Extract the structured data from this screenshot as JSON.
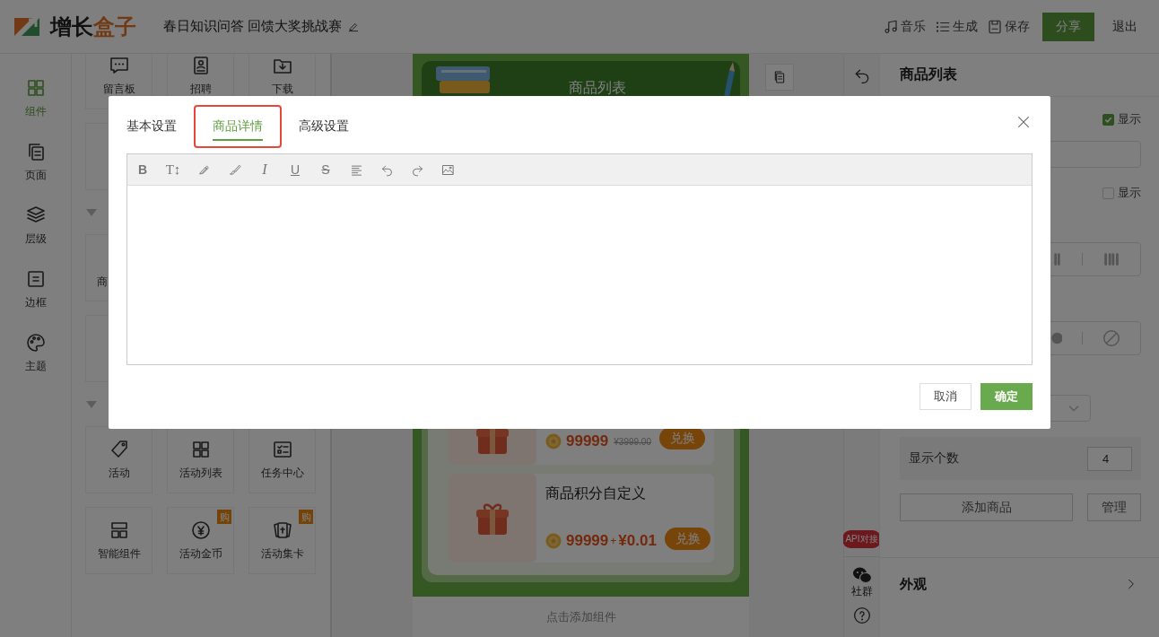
{
  "header": {
    "logo": {
      "text": "增长",
      "accent": "盒子"
    },
    "project_title": "春日知识问答 回馈大奖挑战赛",
    "actions": [
      {
        "kind": "music",
        "label": "音乐"
      },
      {
        "kind": "list",
        "label": "生成"
      },
      {
        "kind": "save",
        "label": "保存"
      }
    ],
    "share_button": "分享",
    "exit_button": "退出"
  },
  "rail": {
    "items": [
      {
        "kind": "grid",
        "label": "组件",
        "selected": true
      },
      {
        "kind": "pages",
        "label": "页面",
        "selected": false
      },
      {
        "kind": "layers",
        "label": "层级",
        "selected": false
      },
      {
        "kind": "border",
        "label": "边框",
        "selected": false
      },
      {
        "kind": "palette",
        "label": "主题",
        "selected": false
      }
    ]
  },
  "component_panel": {
    "rows": [
      {
        "kind": "cards",
        "cards": [
          {
            "kind": "message",
            "label": "留言板"
          },
          {
            "kind": "recruit",
            "label": "招聘"
          },
          {
            "kind": "download",
            "label": "下载"
          }
        ]
      },
      {
        "kind": "cards",
        "cards": [
          {
            "kind": "blank"
          }
        ]
      },
      {
        "kind": "section",
        "expanded": true
      },
      {
        "kind": "cards",
        "cards": [
          {
            "kind": "blank",
            "label": "商"
          }
        ]
      },
      {
        "kind": "cards",
        "cards": [
          {
            "kind": "blank"
          }
        ]
      },
      {
        "kind": "section",
        "expanded": true
      },
      {
        "kind": "cards",
        "cards": [
          {
            "kind": "tag",
            "label": "活动"
          },
          {
            "kind": "grid",
            "label": "活动列表"
          },
          {
            "kind": "tasks",
            "label": "任务中心"
          }
        ]
      },
      {
        "kind": "cards",
        "cards": [
          {
            "kind": "layout",
            "label": "智能组件"
          },
          {
            "kind": "coin",
            "label": "活动金币",
            "badge": "购"
          },
          {
            "kind": "cards",
            "label": "活动集卡",
            "badge": "购"
          }
        ]
      }
    ]
  },
  "canvas": {
    "banner_title": "商品列表",
    "products": [
      {
        "kind": "cut",
        "points": "99999",
        "original_price": "¥3999.00",
        "button": "兑换"
      },
      {
        "kind": "full",
        "name": "商品积分自定义",
        "points": "99999",
        "plus": "+",
        "cash": "¥0.01",
        "button": "兑换"
      }
    ],
    "add_component": "点击添加组件"
  },
  "side_column": {
    "api_badge": "API对接",
    "community": "社群"
  },
  "right_panel": {
    "title": "商品列表",
    "show_first": {
      "label": "显示",
      "checked": true
    },
    "show_second": {
      "label": "显示",
      "checked": false
    },
    "count": {
      "label": "显示个数",
      "value": "4"
    },
    "add_button": "添加商品",
    "manage_button": "管理",
    "appearance": "外观"
  },
  "modal": {
    "tabs": [
      {
        "label": "基本设置",
        "selected": false,
        "highlighted": false
      },
      {
        "label": "商品详情",
        "selected": true,
        "highlighted": true
      },
      {
        "label": "高级设置",
        "selected": false,
        "highlighted": false
      }
    ],
    "toolbar": [
      {
        "kind": "bold",
        "label": "B"
      },
      {
        "kind": "size",
        "label": "T↕"
      },
      {
        "kind": "pen"
      },
      {
        "kind": "brush"
      },
      {
        "kind": "italic",
        "label": "I"
      },
      {
        "kind": "underline",
        "label": "U"
      },
      {
        "kind": "strike",
        "label": "S"
      },
      {
        "kind": "align"
      },
      {
        "kind": "undo"
      },
      {
        "kind": "redo"
      },
      {
        "kind": "image"
      }
    ],
    "cancel_button": "取消",
    "confirm_button": "确定"
  }
}
